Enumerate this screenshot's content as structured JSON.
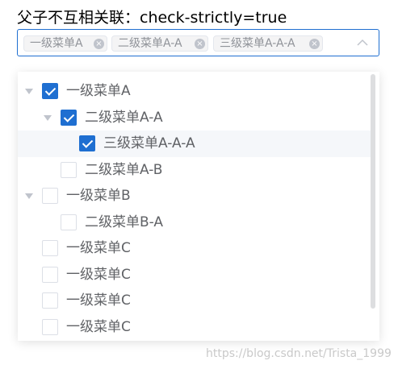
{
  "page": {
    "title": "父子不互相关联：check-strictly=true"
  },
  "select": {
    "tags": [
      {
        "label": "一级菜单A"
      },
      {
        "label": "二级菜单A-A"
      },
      {
        "label": "三级菜单A-A-A"
      }
    ],
    "arrow_icon": "arrow-up-icon"
  },
  "tree": {
    "nodes": [
      {
        "label": "一级菜单A",
        "checked": true,
        "expanded": true,
        "level": 1
      },
      {
        "label": "二级菜单A-A",
        "checked": true,
        "expanded": true,
        "level": 2
      },
      {
        "label": "三级菜单A-A-A",
        "checked": true,
        "level": 3
      },
      {
        "label": "二级菜单A-B",
        "checked": false,
        "level": 2
      },
      {
        "label": "一级菜单B",
        "checked": false,
        "expanded": true,
        "level": 1
      },
      {
        "label": "二级菜单B-A",
        "checked": false,
        "level": 2
      },
      {
        "label": "一级菜单C",
        "checked": false,
        "level": 1
      },
      {
        "label": "一级菜单C",
        "checked": false,
        "level": 1
      },
      {
        "label": "一级菜单C",
        "checked": false,
        "level": 1
      },
      {
        "label": "一级菜单C",
        "checked": false,
        "level": 1
      }
    ]
  },
  "watermark": "https://blog.csdn.net/Trista_1999",
  "colors": {
    "primary": "#1f6fd1",
    "text": "#606266",
    "tag_text": "#909399",
    "tag_bg": "#f4f4f5"
  }
}
